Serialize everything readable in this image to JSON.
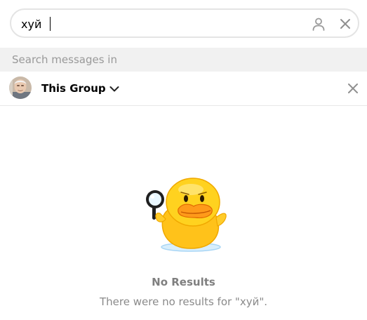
{
  "search": {
    "value": "хуй",
    "user_filter_icon": "person-icon",
    "clear_icon": "close-icon"
  },
  "section": {
    "label": "Search messages in"
  },
  "chat": {
    "name": "This Group",
    "avatar_icon": "group-avatar",
    "dropdown_icon": "chevron-down-icon",
    "close_icon": "close-icon"
  },
  "empty_state": {
    "sticker": "duck-with-magnifier-sticker",
    "title": "No Results",
    "description": "There were no results for \"хуй\"."
  },
  "colors": {
    "section_background": "#f1f1f1",
    "muted_text": "#999999",
    "empty_title": "#7f7f7f",
    "duck_yellow": "#ffd21f",
    "duck_beak": "#ff8a00"
  }
}
